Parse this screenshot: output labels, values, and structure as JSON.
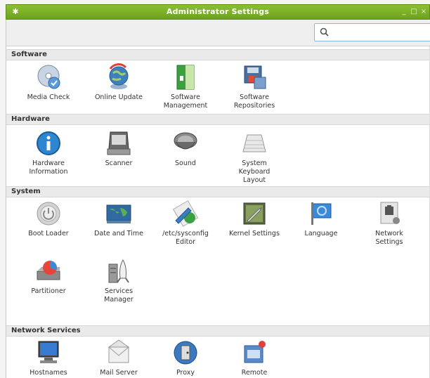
{
  "window": {
    "title": "Administrator Settings"
  },
  "search": {
    "placeholder": "",
    "value": ""
  },
  "sections": {
    "software": {
      "title": "Software",
      "items": [
        {
          "label": "Media Check",
          "icon": "media-check-icon"
        },
        {
          "label": "Online Update",
          "icon": "online-update-icon"
        },
        {
          "label": "Software\nManagement",
          "icon": "software-management-icon"
        },
        {
          "label": "Software\nRepositories",
          "icon": "software-repositories-icon"
        }
      ]
    },
    "hardware": {
      "title": "Hardware",
      "items": [
        {
          "label": "Hardware\nInformation",
          "icon": "hardware-information-icon"
        },
        {
          "label": "Scanner",
          "icon": "scanner-icon"
        },
        {
          "label": "Sound",
          "icon": "sound-icon"
        },
        {
          "label": "System\nKeyboard\nLayout",
          "icon": "keyboard-icon"
        }
      ]
    },
    "system": {
      "title": "System",
      "items": [
        {
          "label": "Boot Loader",
          "icon": "boot-loader-icon"
        },
        {
          "label": "Date and Time",
          "icon": "date-time-icon"
        },
        {
          "label": "/etc/sysconfig\nEditor",
          "icon": "sysconfig-editor-icon"
        },
        {
          "label": "Kernel Settings",
          "icon": "kernel-settings-icon"
        },
        {
          "label": "Language",
          "icon": "language-icon"
        },
        {
          "label": "Network\nSettings",
          "icon": "network-settings-icon"
        },
        {
          "label": "Partitioner",
          "icon": "partitioner-icon"
        },
        {
          "label": "Services\nManager",
          "icon": "services-manager-icon"
        }
      ]
    },
    "network_services": {
      "title": "Network Services",
      "items": [
        {
          "label": "Hostnames",
          "icon": "hostnames-icon"
        },
        {
          "label": "Mail Server",
          "icon": "mail-server-icon"
        },
        {
          "label": "Proxy",
          "icon": "proxy-icon"
        },
        {
          "label": "Remote",
          "icon": "remote-icon"
        }
      ]
    }
  },
  "colors": {
    "titlebar": "#7ab22a",
    "search_border": "#8ab4e0",
    "section_bg": "#eaeaea"
  }
}
